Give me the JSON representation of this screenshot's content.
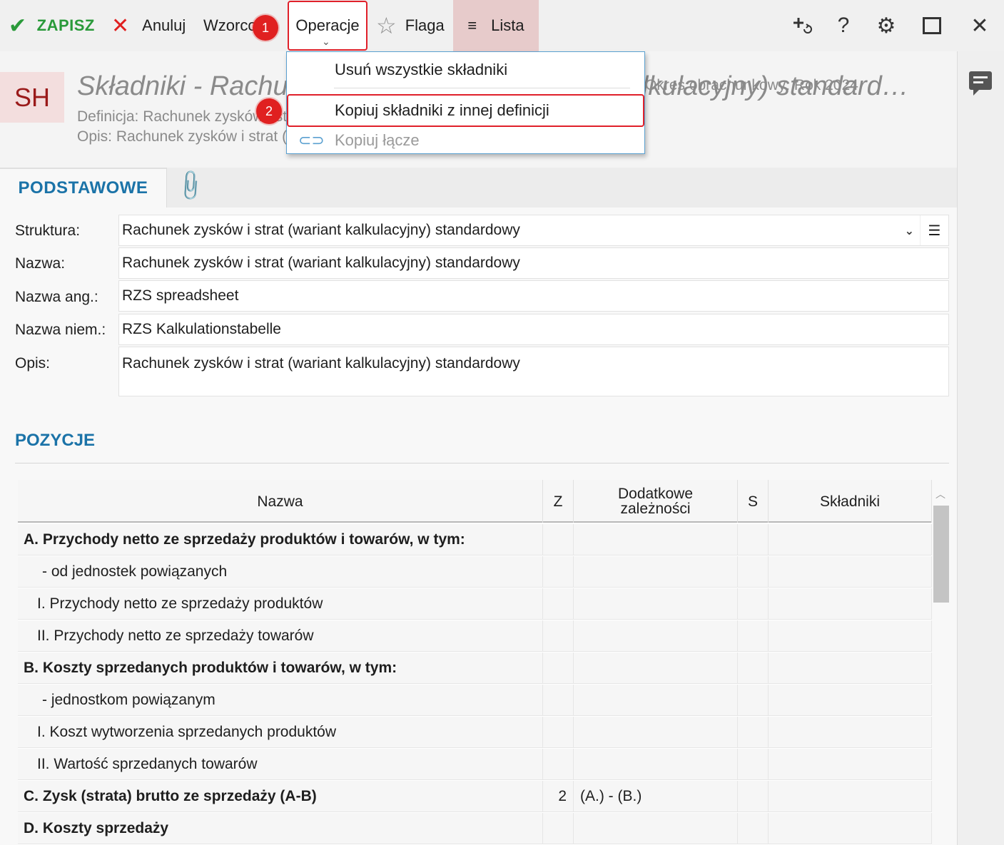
{
  "toolbar": {
    "save_label": "ZAPISZ",
    "cancel_label": "Anuluj",
    "templates_label": "Wzorcowe",
    "operations_label": "Operacje",
    "flag_label": "Flaga",
    "list_label": "Lista",
    "right_icons": [
      "add-related-icon",
      "help-icon",
      "settings-icon",
      "maximize-icon",
      "close-icon"
    ]
  },
  "annotations": {
    "badge1": "1",
    "badge2": "2"
  },
  "operations_menu": {
    "items": [
      {
        "label": "Usuń wszystkie składniki",
        "enabled": true
      },
      {
        "label": "Kopiuj składniki z innej definicji",
        "enabled": true,
        "highlighted": true
      },
      {
        "label": "Kopiuj łącze",
        "enabled": false,
        "icon": "link-icon"
      }
    ]
  },
  "header": {
    "badge": "SH",
    "title": "Składniki - Rachunek zysków i strat (wariant kalkulacyjny) standard…",
    "definition": "Definicja: Rachunek zysków i strat (wariant kalkulacyjny) standardowy",
    "description": "Opis: Rachunek zysków i strat (wariant kalkulacyjny) standardowy",
    "fiscal_year": "Okres obrachunkowy: Rok 2024"
  },
  "tabs": {
    "active": "PODSTAWOWE",
    "attachments_icon": "paperclip-icon"
  },
  "form": {
    "structure_label": "Struktura:",
    "structure_value": "Rachunek zysków i strat (wariant kalkulacyjny) standardowy",
    "name_label": "Nazwa:",
    "name_value": "Rachunek zysków i strat (wariant kalkulacyjny) standardowy",
    "name_en_label": "Nazwa ang.:",
    "name_en_value": "RZS spreadsheet",
    "name_de_label": "Nazwa niem.:",
    "name_de_value": "RZS Kalkulationstabelle",
    "desc_label": "Opis:",
    "desc_value": "Rachunek zysków i strat (wariant kalkulacyjny) standardowy"
  },
  "positions": {
    "title": "POZYCJE",
    "columns": [
      "Nazwa",
      "Z",
      "Dodatkowe zależności",
      "S",
      "Składniki"
    ],
    "rows": [
      {
        "name": "A. Przychody netto ze sprzedaży produktów i towarów, w tym:",
        "bold": true,
        "indent": 0,
        "z": "",
        "deps": "",
        "s": "",
        "components": ""
      },
      {
        "name": "- od jednostek powiązanych",
        "bold": false,
        "indent": 2,
        "z": "",
        "deps": "",
        "s": "",
        "components": ""
      },
      {
        "name": "I. Przychody netto ze sprzedaży produktów",
        "bold": false,
        "indent": 1,
        "z": "",
        "deps": "",
        "s": "",
        "components": ""
      },
      {
        "name": "II. Przychody netto ze sprzedaży towarów",
        "bold": false,
        "indent": 1,
        "z": "",
        "deps": "",
        "s": "",
        "components": ""
      },
      {
        "name": "B. Koszty sprzedanych produktów i towarów, w tym:",
        "bold": true,
        "indent": 0,
        "z": "",
        "deps": "",
        "s": "",
        "components": ""
      },
      {
        "name": "- jednostkom powiązanym",
        "bold": false,
        "indent": 2,
        "z": "",
        "deps": "",
        "s": "",
        "components": ""
      },
      {
        "name": "I. Koszt wytworzenia sprzedanych produktów",
        "bold": false,
        "indent": 1,
        "z": "",
        "deps": "",
        "s": "",
        "components": ""
      },
      {
        "name": "II. Wartość sprzedanych towarów",
        "bold": false,
        "indent": 1,
        "z": "",
        "deps": "",
        "s": "",
        "components": ""
      },
      {
        "name": "C. Zysk (strata) brutto ze sprzedaży (A-B)",
        "bold": true,
        "indent": 0,
        "z": "2",
        "deps": "(A.) - (B.)",
        "s": "",
        "components": ""
      },
      {
        "name": "D. Koszty sprzedaży",
        "bold": true,
        "indent": 0,
        "z": "",
        "deps": "",
        "s": "",
        "components": ""
      }
    ]
  },
  "side_panel": {
    "icon": "comment-icon"
  },
  "colors": {
    "accent": "#1b73a8",
    "save": "#2a9a3a",
    "cancel": "#e02020",
    "highlight": "#e0202a",
    "badge": "#9a1a1a",
    "lista_bg": "#e7cbcb"
  }
}
